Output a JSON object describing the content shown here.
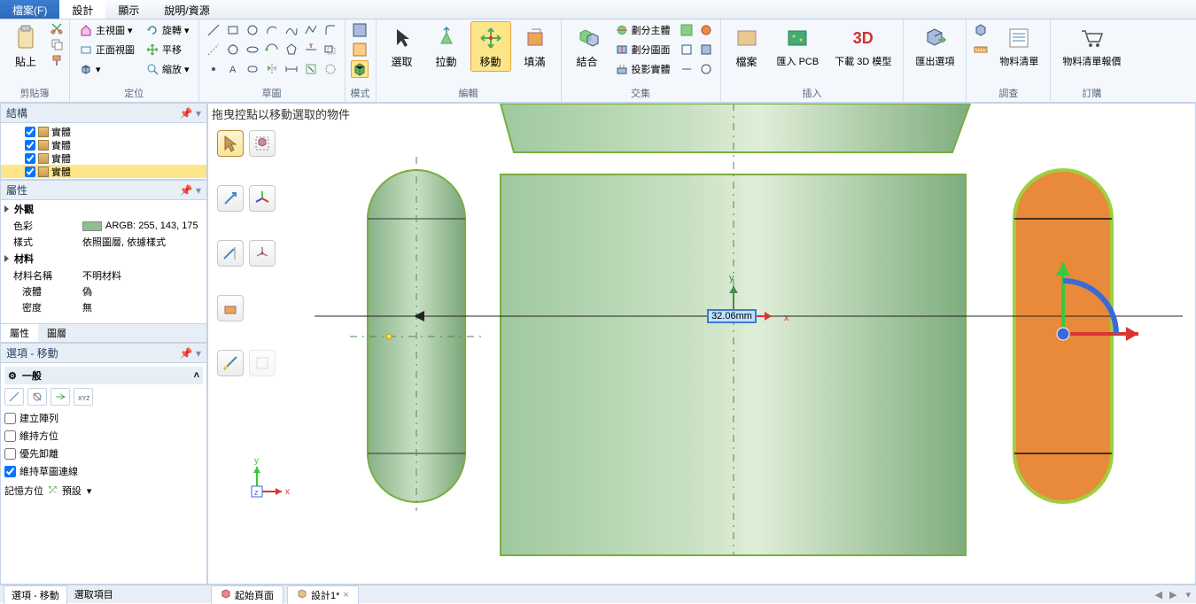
{
  "menu": {
    "file": "檔案(F)",
    "design": "設計",
    "display": "顯示",
    "help": "說明/資源"
  },
  "ribbon": {
    "groups": {
      "clipboard": {
        "title": "剪貼簿",
        "paste": "貼上"
      },
      "orient": {
        "title": "定位",
        "home": "主視圖",
        "plan": "正面視圖",
        "rotate": "旋轉",
        "pan": "平移",
        "zoom": "縮放"
      },
      "sketch": {
        "title": "草圖"
      },
      "mode": {
        "title": "模式"
      },
      "edit": {
        "title": "編輯",
        "select": "選取",
        "pull": "拉動",
        "move": "移動",
        "fill": "填滿"
      },
      "intersect": {
        "title": "交集",
        "combine": "結合",
        "split_body": "劃分主體",
        "split_face": "劃分圖面",
        "project": "投影實體"
      },
      "insert": {
        "title": "插入",
        "file": "檔案",
        "import_pcb": "匯入 PCB",
        "download_3d": "下載 3D 模型"
      },
      "export": {
        "export": "匯出選項"
      },
      "review": {
        "title": "調查",
        "material_list": "物料清單"
      },
      "order": {
        "title": "訂購",
        "quote": "物料清單報價"
      }
    }
  },
  "panels": {
    "structure": {
      "title": "結構",
      "items": [
        "實體",
        "實體",
        "實體",
        "實體"
      ]
    },
    "properties": {
      "title": "屬性",
      "appearance": "外觀",
      "color": "色彩",
      "color_value": "ARGB: 255, 143, 175",
      "style": "樣式",
      "style_value": "依照圖層, 依據樣式",
      "material": "材料",
      "material_name": "材料名稱",
      "material_value": "不明材料",
      "fluid": "液體",
      "fluid_value": "偽",
      "density": "密度",
      "density_value": "無"
    },
    "prop_tabs": {
      "p": "屬性",
      "l": "圖層"
    },
    "options": {
      "title": "選項 - 移動",
      "general": "一般",
      "create_pattern": "建立陣列",
      "maintain_orient": "維持方位",
      "detach_first": "優先卸離",
      "maintain_sketch": "維持草圖連線",
      "remember": "記憶方位",
      "remember_value": "預設"
    },
    "bottom_tabs": {
      "opt": "選項 - 移動",
      "sel": "選取項目"
    }
  },
  "canvas": {
    "hint": "拖曳控點以移動選取的物件",
    "dim_value": "32.06mm",
    "axes": {
      "x": "x",
      "y": "y",
      "z": "z"
    }
  },
  "doc_tabs": {
    "start": "起始頁面",
    "design1": "設計1*"
  }
}
